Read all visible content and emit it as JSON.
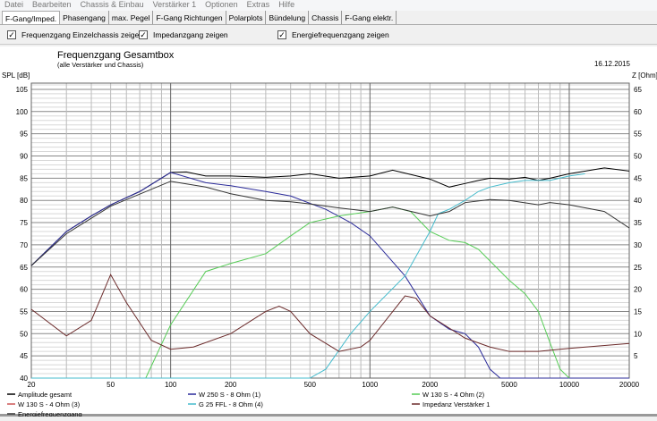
{
  "menu": [
    "Datei",
    "Bearbeiten",
    "Chassis & Einbau",
    "Verstärker 1",
    "Optionen",
    "Extras",
    "Hilfe"
  ],
  "tabs": [
    "F-Gang/Imped.",
    "Phasengang",
    "max. Pegel",
    "F-Gang Richtungen",
    "Polarplots",
    "Bündelung",
    "Chassis",
    "F-Gang elektr."
  ],
  "options": [
    {
      "label": "Frequenzgang Einzelchassis zeigen",
      "checked": true
    },
    {
      "label": "Impedanzgang zeigen",
      "checked": true
    },
    {
      "label": "Energiefrequenzgang zeigen",
      "checked": true
    }
  ],
  "chart_data": {
    "type": "line",
    "title": "Frequenzgang Gesamtbox",
    "subtitle": "(alle Verstärker und Chassis)",
    "date": "16.12.2015",
    "ylabel": "SPL [dB]",
    "y2label": "Z [Ohm]",
    "xscale": "log",
    "xlim": [
      20,
      20000
    ],
    "ylim": [
      40,
      106.4
    ],
    "y2lim": [
      0,
      66.4
    ],
    "xticks": [
      20,
      50,
      100,
      200,
      500,
      1000,
      2000,
      5000,
      10000,
      20000
    ],
    "yticks": [
      40,
      45,
      50,
      55,
      60,
      65,
      70,
      75,
      80,
      85,
      90,
      95,
      100,
      105
    ],
    "y2ticks": [
      5,
      10,
      15,
      20,
      25,
      30,
      35,
      40,
      45,
      50,
      55,
      60,
      65
    ],
    "grid": true,
    "series": [
      {
        "name": "Amplitude gesamt",
        "color": "#000000",
        "axis": "spl",
        "x": [
          20,
          30,
          40,
          50,
          70,
          100,
          120,
          150,
          200,
          300,
          400,
          500,
          700,
          1000,
          1300,
          2000,
          2500,
          3000,
          3500,
          4000,
          5000,
          6000,
          7000,
          8000,
          10000,
          15000,
          20000
        ],
        "y": [
          65.3,
          73,
          76.5,
          79,
          82,
          86.3,
          86.4,
          85.5,
          85.5,
          85.2,
          85.5,
          86,
          85,
          85.5,
          86.8,
          84.8,
          83,
          83.8,
          84.5,
          85,
          84.8,
          85.2,
          84.5,
          85,
          86,
          87.3,
          86.6
        ]
      },
      {
        "name": "W 250 S - 8 Ohm (1)",
        "color": "#2b2b9a",
        "axis": "spl",
        "x": [
          20,
          30,
          40,
          50,
          70,
          100,
          150,
          200,
          300,
          400,
          600,
          800,
          1000,
          1500,
          2000,
          2500,
          3000,
          3500,
          4000,
          4500,
          20000
        ],
        "y": [
          65.3,
          73,
          76.5,
          79,
          82,
          86.3,
          84,
          83.3,
          82,
          81,
          78,
          75,
          72,
          63,
          54,
          51,
          50,
          47,
          42,
          40,
          40
        ]
      },
      {
        "name": "W 130 S - 4 Ohm (2)",
        "color": "#55cc55",
        "axis": "spl",
        "x": [
          20,
          75,
          100,
          150,
          200,
          300,
          400,
          500,
          700,
          1000,
          1300,
          1600,
          2000,
          2500,
          3000,
          3500,
          5000,
          6000,
          7000,
          8000,
          9000,
          10000
        ],
        "y": [
          40,
          40,
          52,
          64,
          65.8,
          68,
          72,
          75,
          76.5,
          77.5,
          78.5,
          77.5,
          73,
          71,
          70.5,
          69,
          62,
          59,
          55,
          48,
          42,
          40
        ]
      },
      {
        "name": "W 130 S - 4 Ohm (3)",
        "color": "#cc5555",
        "axis": "spl",
        "x": [],
        "y": []
      },
      {
        "name": "G 25 FFL - 8 Ohm (4)",
        "color": "#44bbcc",
        "axis": "spl",
        "x": [
          20,
          500,
          600,
          800,
          1000,
          1500,
          2000,
          2200,
          2500,
          3000,
          3500,
          4000,
          5000,
          6000,
          8000,
          10000,
          12000
        ],
        "y": [
          40,
          40,
          42,
          50,
          55,
          63,
          73,
          77,
          78,
          80,
          82,
          83,
          84,
          84.5,
          84.5,
          85.5,
          86
        ]
      },
      {
        "name": "Impedanz Verstärker 1",
        "color": "#6b2a2a",
        "axis": "z",
        "x": [
          20,
          30,
          40,
          50,
          60,
          80,
          100,
          130,
          200,
          300,
          350,
          400,
          500,
          700,
          900,
          1000,
          1500,
          1700,
          2000,
          3000,
          4000,
          5000,
          7000,
          10000,
          20000
        ],
        "y": [
          15.5,
          9.5,
          13,
          23.3,
          17,
          8.5,
          6.5,
          7,
          10,
          15,
          16.2,
          15,
          10,
          6,
          7,
          8.5,
          18.5,
          18,
          14,
          9,
          7,
          6,
          6,
          6.7,
          7.8
        ]
      },
      {
        "name": "Energiefrequenzgang",
        "color": "#333333",
        "axis": "spl",
        "x": [
          20,
          30,
          50,
          100,
          150,
          200,
          300,
          400,
          500,
          700,
          1000,
          1300,
          1800,
          2000,
          2500,
          3000,
          4000,
          5000,
          7000,
          8000,
          10000,
          15000,
          20000
        ],
        "y": [
          65.3,
          72.5,
          78.7,
          84.3,
          83,
          81.5,
          80,
          79.7,
          79.2,
          78.3,
          77.5,
          78.5,
          77,
          76.5,
          77.5,
          79.5,
          80.2,
          80,
          79,
          79.5,
          79,
          77.5,
          73.8
        ]
      }
    ]
  }
}
